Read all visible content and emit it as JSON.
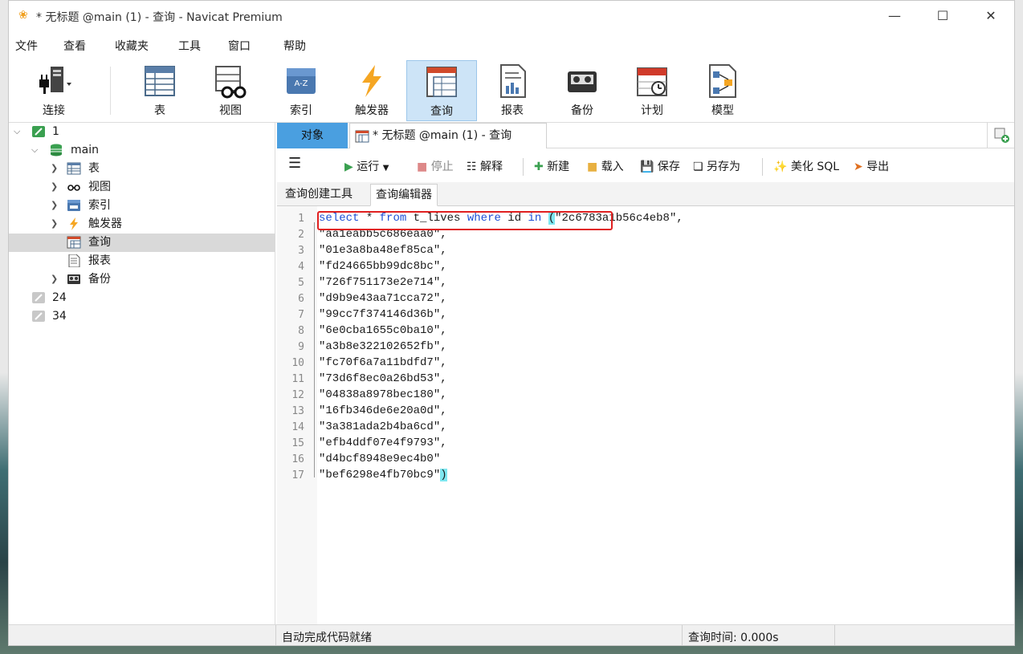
{
  "window": {
    "title": "* 无标题 @main (1) - 查询 - Navicat Premium",
    "minimize": "—",
    "maximize": "☐",
    "close": "✕"
  },
  "menu": [
    "文件",
    "查看",
    "收藏夹",
    "工具",
    "窗口",
    "帮助"
  ],
  "toolbar": [
    {
      "label": "连接",
      "icon": "connection-icon"
    },
    {
      "label": "表",
      "icon": "table-icon"
    },
    {
      "label": "视图",
      "icon": "view-icon"
    },
    {
      "label": "索引",
      "icon": "index-icon"
    },
    {
      "label": "触发器",
      "icon": "trigger-icon"
    },
    {
      "label": "查询",
      "icon": "query-icon",
      "active": true
    },
    {
      "label": "报表",
      "icon": "report-icon"
    },
    {
      "label": "备份",
      "icon": "backup-icon"
    },
    {
      "label": "计划",
      "icon": "schedule-icon"
    },
    {
      "label": "模型",
      "icon": "model-icon"
    }
  ],
  "tree": {
    "conn1": "1",
    "db": "main",
    "items": [
      "表",
      "视图",
      "索引",
      "触发器",
      "查询",
      "报表",
      "备份"
    ],
    "conn2": "24",
    "conn3": "34"
  },
  "tabs": {
    "objects": "对象",
    "query": "* 无标题 @main (1) - 查询"
  },
  "qtoolbar": {
    "run": "运行",
    "stop": "停止",
    "explain": "解释",
    "new": "新建",
    "load": "载入",
    "save": "保存",
    "save_as": "另存为",
    "beautify": "美化 SQL",
    "export": "导出"
  },
  "subtabs": [
    "查询创建工具",
    "查询编辑器"
  ],
  "editor": {
    "line1": {
      "kw1": "select",
      "t1": " * ",
      "kw2": "from",
      "t2": " t_lives ",
      "kw3": "where",
      "t3": " id ",
      "kw4": "in",
      "paren": "(",
      "rest": "\"2c6783a1b56c4eb8\","
    },
    "lines": [
      "\"aa1eabb5c686eaa0\",",
      "\"01e3a8ba48ef85ca\",",
      "\"fd24665bb99dc8bc\",",
      "\"726f751173e2e714\",",
      "\"d9b9e43aa71cca72\",",
      "\"99cc7f374146d36b\",",
      "\"6e0cba1655c0ba10\",",
      "\"a3b8e322102652fb\",",
      "\"fc70f6a7a11bdfd7\",",
      "\"73d6f8ec0a26bd53\",",
      "\"04838a8978bec180\",",
      "\"16fb346de6e20a0d\",",
      "\"3a381ada2b4ba6cd\",",
      "\"efb4ddf07e4f9793\",",
      "\"d4bcf8948e9ec4b0\""
    ],
    "last_line": "\"bef6298e4fb70bc9\"",
    "last_paren": ")",
    "line_numbers": [
      "1",
      "2",
      "3",
      "4",
      "5",
      "6",
      "7",
      "8",
      "9",
      "10",
      "11",
      "12",
      "13",
      "14",
      "15",
      "16",
      "17"
    ]
  },
  "status": {
    "left": "自动完成代码就绪",
    "query_time": "查询时间: 0.000s"
  }
}
